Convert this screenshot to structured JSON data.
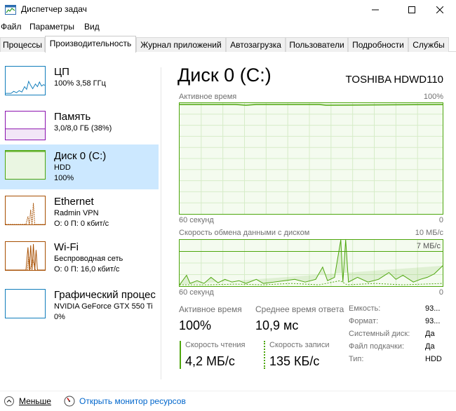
{
  "window": {
    "title": "Диспетчер задач"
  },
  "menu": [
    "Файл",
    "Параметры",
    "Вид"
  ],
  "tabs": [
    "Процессы",
    "Производительность",
    "Журнал приложений",
    "Автозагрузка",
    "Пользователи",
    "Подробности",
    "Службы"
  ],
  "sidebar": [
    {
      "title": "ЦП",
      "sub1": "100% 3,58 ГГц",
      "sub2": "",
      "color": "#117dbb"
    },
    {
      "title": "Память",
      "sub1": "3,0/8,0 ГБ (38%)",
      "sub2": "",
      "color": "#8b12ae"
    },
    {
      "title": "Диск 0 (C:)",
      "sub1": "HDD",
      "sub2": "100%",
      "color": "#4da60c"
    },
    {
      "title": "Ethernet",
      "sub1": "Radmin VPN",
      "sub2": "О: 0 П: 0 кбит/с",
      "color": "#a74f01"
    },
    {
      "title": "Wi-Fi",
      "sub1": "Беспроводная сеть",
      "sub2": "О: 0 П: 16,0 кбит/с",
      "color": "#a74f01"
    },
    {
      "title": "Графический процес",
      "sub1": "NVIDIA GeForce GTX 550 Ti",
      "sub2": "0%",
      "color": "#117dbb"
    }
  ],
  "main": {
    "title": "Диск 0 (C:)",
    "model": "TOSHIBA HDWD110",
    "chart1": {
      "label": "Активное время",
      "max": "100%",
      "xlabel": "60 секунд",
      "min": "0",
      "level_percent": 100
    },
    "chart2": {
      "label": "Скорость обмена данными с диском",
      "max": "10 МБ/с",
      "inner_max": "7 МБ/с",
      "xlabel": "60 секунд",
      "min": "0"
    },
    "stats": {
      "active_label": "Активное время",
      "active_value": "100%",
      "resp_label": "Среднее время ответа",
      "resp_value": "10,9 мс",
      "read_label": "Скорость чтения",
      "read_value": "4,2 МБ/с",
      "write_label": "Скорость записи",
      "write_value": "135 КБ/с"
    },
    "props": [
      {
        "k": "Емкость:",
        "v": "93..."
      },
      {
        "k": "Формат:",
        "v": "93..."
      },
      {
        "k": "Системный диск:",
        "v": "Да"
      },
      {
        "k": "Файл подкачки:",
        "v": "Да"
      },
      {
        "k": "Тип:",
        "v": "HDD"
      }
    ]
  },
  "footer": {
    "less": "Меньше",
    "monitor": "Открыть монитор ресурсов"
  }
}
